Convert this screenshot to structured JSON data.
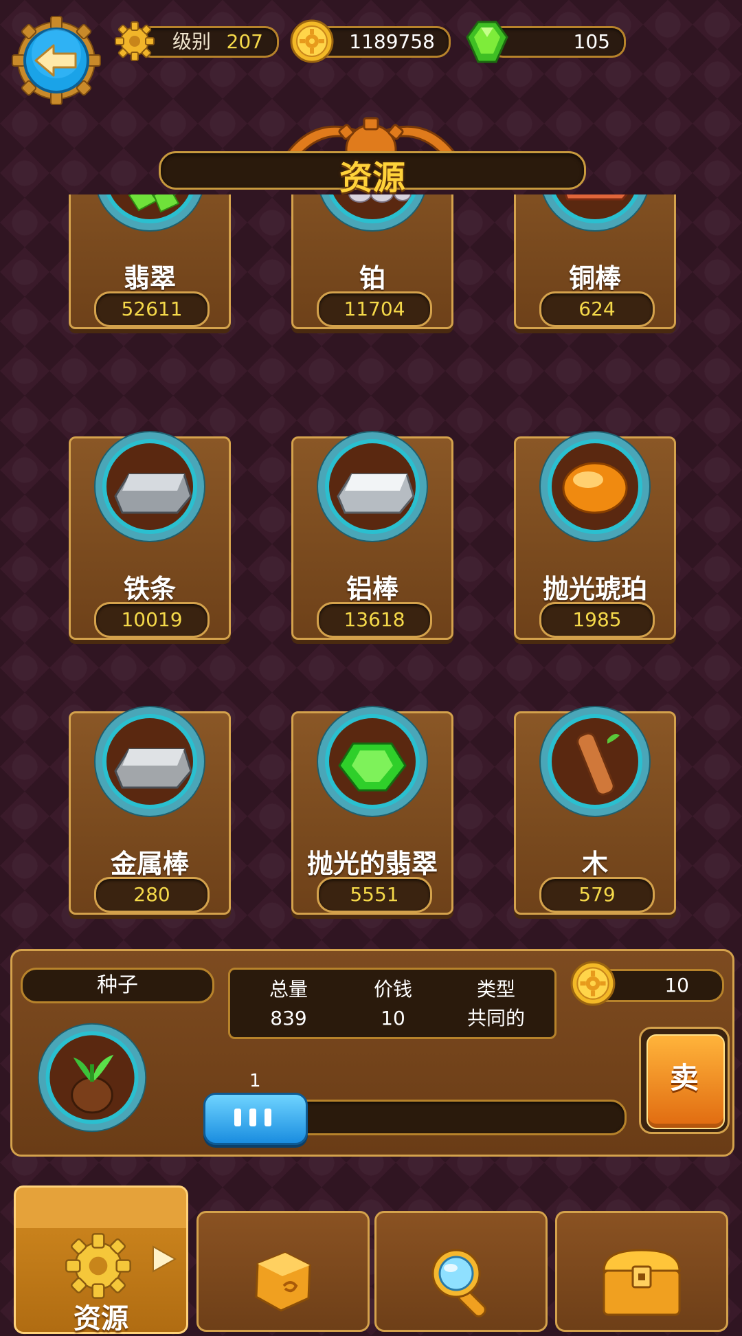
{
  "header": {
    "level_label": "级别",
    "level_value": "207",
    "coins": "1189758",
    "gems": "105"
  },
  "title": "资源",
  "resources": [
    {
      "name": "翡翠",
      "count": "52611",
      "icon": "emerald-pile-icon"
    },
    {
      "name": "铂",
      "count": "11704",
      "icon": "platinum-ore-icon"
    },
    {
      "name": "铜棒",
      "count": "624",
      "icon": "copper-bar-icon"
    },
    {
      "name": "铁条",
      "count": "10019",
      "icon": "iron-bar-icon"
    },
    {
      "name": "铝棒",
      "count": "13618",
      "icon": "aluminum-bar-icon"
    },
    {
      "name": "抛光琥珀",
      "count": "1985",
      "icon": "polished-amber-icon"
    },
    {
      "name": "金属棒",
      "count": "280",
      "icon": "metal-bar-icon"
    },
    {
      "name": "抛光的翡翠",
      "count": "5551",
      "icon": "polished-emerald-icon"
    },
    {
      "name": "木",
      "count": "579",
      "icon": "wood-log-icon"
    }
  ],
  "detail": {
    "name": "种子",
    "total_label": "总量",
    "total_value": "839",
    "price_label": "价钱",
    "price_value": "10",
    "type_label": "类型",
    "type_value": "共同的",
    "sell_price": "10",
    "slider_value": "1",
    "sell_label": "卖",
    "icon": "seed-sprout-icon"
  },
  "tabs": {
    "resources_label": "资源"
  },
  "colors": {
    "background": "#3a1a2a",
    "panel": "#7d4b20",
    "border_gold": "#d4a24c",
    "value_yellow": "#f5d94a",
    "title_yellow": "#ffd23a",
    "slider_blue": "#1a8de0",
    "sell_orange": "#e06a10"
  }
}
